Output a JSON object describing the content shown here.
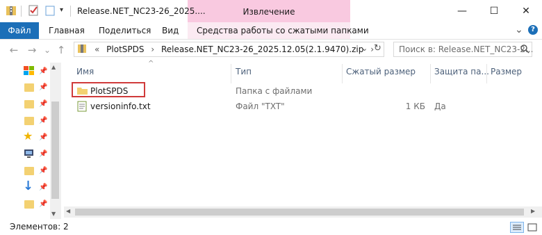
{
  "window": {
    "title": "Release.NET_NC23-26_2025....",
    "context_tab": "Извлечение",
    "controls": {
      "minimize": "—",
      "maximize": "☐",
      "close": "✕"
    }
  },
  "ribbon": {
    "tabs": [
      "Файл",
      "Главная",
      "Поделиться",
      "Вид",
      "Средства работы со сжатыми папками"
    ],
    "collapse_icon": "⌄",
    "help_icon": "?"
  },
  "address": {
    "back": "←",
    "forward": "→",
    "recent": "⌄",
    "up": "↑",
    "overflow": "«",
    "crumbs": [
      "PlotSPDS",
      "Release.NET_NC23-26_2025.12.05(2.1.9470).zip"
    ],
    "separator": "›",
    "dropdown": "⌄",
    "refresh": "↻",
    "search_placeholder": "Поиск в: Release.NET_NC23-2..."
  },
  "columns": {
    "name": "Имя",
    "type": "Тип",
    "compressed": "Сжатый размер",
    "protected": "Защита па...",
    "size": "Размер"
  },
  "files": [
    {
      "name": "PlotSPDS",
      "type": "Папка с файлами",
      "compressed": "",
      "protected": "",
      "icon": "folder-icon"
    },
    {
      "name": "versioninfo.txt",
      "type": "Файл \"TXT\"",
      "compressed": "1 КБ",
      "protected": "Да",
      "icon": "text-file-icon"
    }
  ],
  "status": {
    "items_count": "Элементов: 2"
  },
  "colors": {
    "accent": "#1c6fb8",
    "context_tab": "#f9c9e0",
    "highlight_border": "#d03a3a"
  }
}
